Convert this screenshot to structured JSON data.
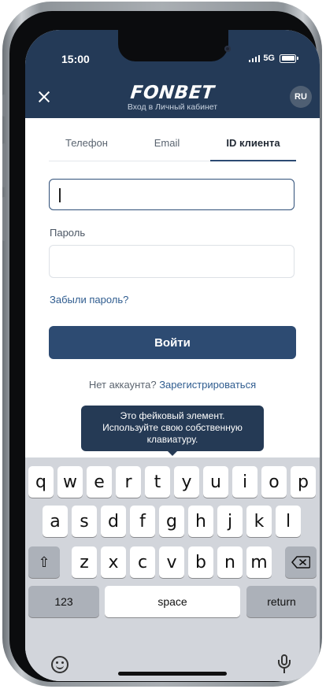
{
  "status_bar": {
    "time": "15:00",
    "network": "5G"
  },
  "app_bar": {
    "logo_text": "FONBET",
    "subtitle": "Вход в Личный кабинет",
    "language": "RU"
  },
  "tabs": [
    {
      "label": "Телефон",
      "active": false
    },
    {
      "label": "Email",
      "active": false
    },
    {
      "label": "ID клиента",
      "active": true
    }
  ],
  "form": {
    "client_id_value": "",
    "password_label": "Пароль",
    "password_value": "",
    "forgot_password": "Забыли пароль?",
    "login_button": "Войти",
    "no_account_text": "Нет аккаунта?",
    "register_link": "Зарегистрироваться"
  },
  "tooltip": {
    "line1": "Это фейковый элемент.",
    "line2": "Используйте свою собственную",
    "line3": "клавиатуру."
  },
  "keyboard": {
    "row1": [
      "q",
      "w",
      "e",
      "r",
      "t",
      "y",
      "u",
      "i",
      "o",
      "p"
    ],
    "row2": [
      "a",
      "s",
      "d",
      "f",
      "g",
      "h",
      "j",
      "k",
      "l"
    ],
    "row3": [
      "z",
      "x",
      "c",
      "v",
      "b",
      "n",
      "m"
    ],
    "numbers_key": "123",
    "space_key": "space",
    "return_key": "return"
  },
  "colors": {
    "header_bg": "#243a57",
    "primary_button": "#2d4b72",
    "link": "#2f5c8f",
    "keyboard_bg": "#d2d5db"
  }
}
